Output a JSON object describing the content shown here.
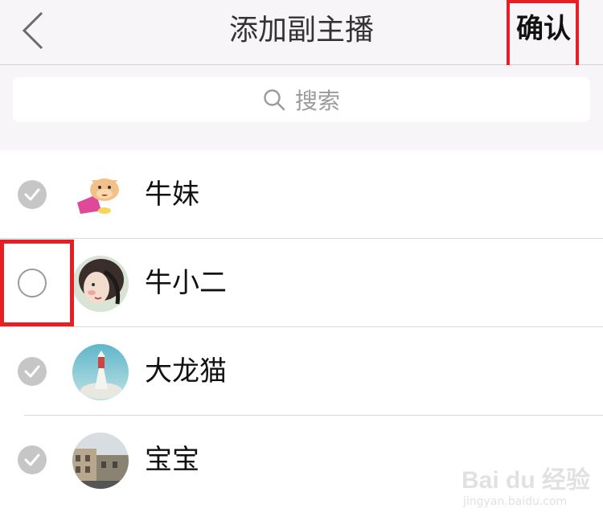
{
  "header": {
    "title": "添加副主播",
    "confirm_label": "确认",
    "back_icon": "chevron-left-icon"
  },
  "search": {
    "placeholder": "搜索",
    "icon": "search-icon"
  },
  "contacts": [
    {
      "name": "牛妹",
      "selected": true,
      "avatar": "cartoon-cow-avatar"
    },
    {
      "name": "牛小二",
      "selected": false,
      "avatar": "sketch-portrait-avatar"
    },
    {
      "name": "大龙猫",
      "selected": true,
      "avatar": "stupa-landscape-avatar"
    },
    {
      "name": "宝宝",
      "selected": true,
      "avatar": "street-building-avatar"
    }
  ],
  "colors": {
    "highlight": "#e51f23",
    "header_bg": "#f7f5f8",
    "check_on": "#c6c6c6",
    "check_off_border": "#9a9a9a"
  },
  "watermark": {
    "brand": "Bai du 经验",
    "url": "jingyan.baidu.com"
  }
}
